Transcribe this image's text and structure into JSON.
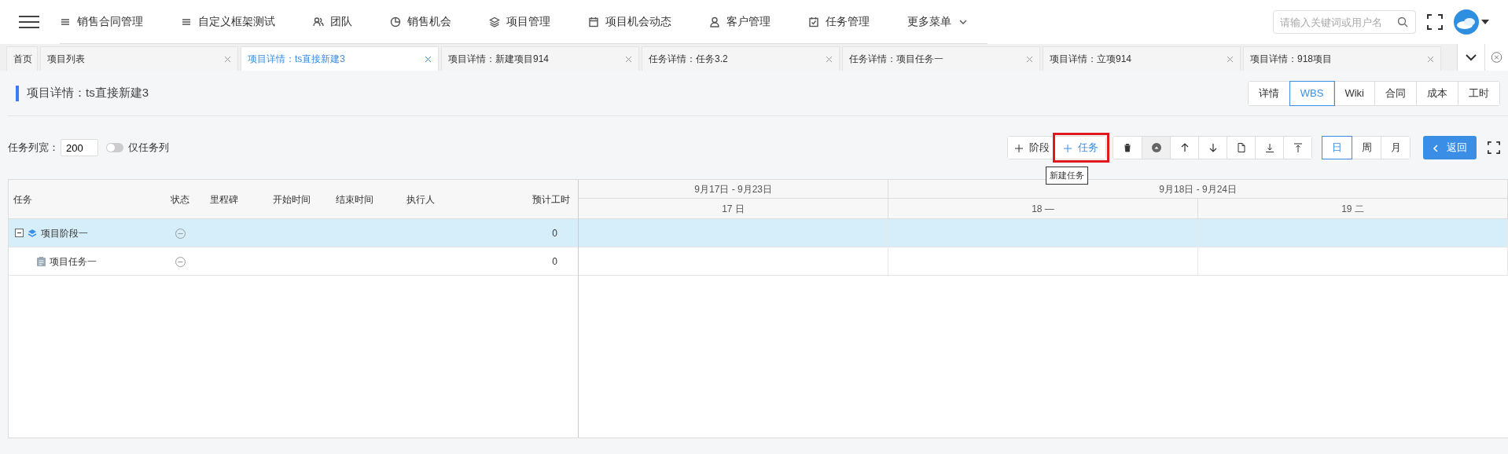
{
  "nav": {
    "items": [
      {
        "label": "销售合同管理"
      },
      {
        "label": "自定义框架测试"
      },
      {
        "label": "团队"
      },
      {
        "label": "销售机会"
      },
      {
        "label": "项目管理"
      },
      {
        "label": "项目机会动态"
      },
      {
        "label": "客户管理"
      },
      {
        "label": "任务管理"
      },
      {
        "label": "更多菜单"
      }
    ],
    "search": {
      "placeholder": "请输入关键词或用户名"
    }
  },
  "tabs": [
    {
      "label": "首页",
      "selected": false,
      "closable": false
    },
    {
      "label": "项目列表",
      "selected": false,
      "closable": true
    },
    {
      "label": "项目详情：ts直接新建3",
      "selected": true,
      "closable": true
    },
    {
      "label": "项目详情：新建项目914",
      "selected": false,
      "closable": true
    },
    {
      "label": "任务详情：任务3.2",
      "selected": false,
      "closable": true
    },
    {
      "label": "任务详情：项目任务一",
      "selected": false,
      "closable": true
    },
    {
      "label": "项目详情：立项914",
      "selected": false,
      "closable": true
    },
    {
      "label": "项目详情：918项目",
      "selected": false,
      "closable": true
    }
  ],
  "page_title": "项目详情：ts直接新建3",
  "views": [
    {
      "label": "详情",
      "selected": false
    },
    {
      "label": "WBS",
      "selected": true
    },
    {
      "label": "Wiki",
      "selected": false
    },
    {
      "label": "合同",
      "selected": false
    },
    {
      "label": "成本",
      "selected": false
    },
    {
      "label": "工时",
      "selected": false
    }
  ],
  "toolbar": {
    "width_label": "任务列宽：",
    "width_value": "200",
    "only_tasks": {
      "label": "仅任务列",
      "on": false
    },
    "add_buttons": [
      {
        "label": "阶段",
        "highlighted": false
      },
      {
        "label": "任务",
        "highlighted": true
      }
    ],
    "tooltip": "新建任务",
    "scales": [
      {
        "label": "日",
        "selected": true
      },
      {
        "label": "周",
        "selected": false
      },
      {
        "label": "月",
        "selected": false
      }
    ],
    "back": "返回"
  },
  "table": {
    "columns": [
      "任务",
      "状态",
      "里程碑",
      "开始时间",
      "结束时间",
      "执行人",
      "预计工时"
    ],
    "rows": [
      {
        "kind": "phase",
        "name": "项目阶段一",
        "expanded": true,
        "selected": true,
        "hours": "0",
        "children": [
          {
            "kind": "task",
            "name": "项目任务一",
            "selected": false,
            "hours": "0"
          }
        ]
      }
    ]
  },
  "gantt": {
    "weeks": [
      "9月17日 - 9月23日",
      "9月18日 - 9月24日"
    ],
    "days": [
      "17 日",
      "18 —",
      "19 二"
    ]
  }
}
